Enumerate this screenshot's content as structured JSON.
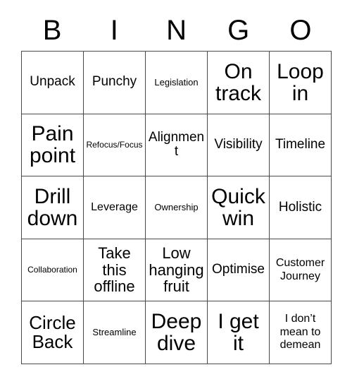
{
  "card": {
    "title_letters": [
      "B",
      "I",
      "N",
      "G",
      "O"
    ],
    "grid_size": 5,
    "border_color": "#4a4a4a",
    "background_color": "#ffffff",
    "text_color": "#000000",
    "rows": [
      [
        {
          "text": "Unpack",
          "size": "ml"
        },
        {
          "text": "Punchy",
          "size": "ml"
        },
        {
          "text": "Legislation",
          "size": "s"
        },
        {
          "text": "On track",
          "size": "xxl"
        },
        {
          "text": "Loop in",
          "size": "xxl"
        }
      ],
      [
        {
          "text": "Pain point",
          "size": "xxl"
        },
        {
          "text": "Refocus/Focus",
          "size": "xs"
        },
        {
          "text": "Alignment",
          "size": "ml"
        },
        {
          "text": "Visibility",
          "size": "ml"
        },
        {
          "text": "Timeline",
          "size": "ml"
        }
      ],
      [
        {
          "text": "Drill down",
          "size": "xxl"
        },
        {
          "text": "Leverage",
          "size": "m"
        },
        {
          "text": "Ownership",
          "size": "s"
        },
        {
          "text": "Quick win",
          "size": "xxl"
        },
        {
          "text": "Holistic",
          "size": "ml"
        }
      ],
      [
        {
          "text": "Collaboration",
          "size": "xs"
        },
        {
          "text": "Take this offline",
          "size": "l"
        },
        {
          "text": "Low hanging fruit",
          "size": "l"
        },
        {
          "text": "Optimise",
          "size": "ml"
        },
        {
          "text": "Customer Journey",
          "size": "m"
        }
      ],
      [
        {
          "text": "Circle Back",
          "size": "xl"
        },
        {
          "text": "Streamline",
          "size": "s"
        },
        {
          "text": "Deep dive",
          "size": "xxl"
        },
        {
          "text": "I get it",
          "size": "xxl"
        },
        {
          "text": "I don’t mean to demean",
          "size": "m"
        }
      ]
    ]
  }
}
